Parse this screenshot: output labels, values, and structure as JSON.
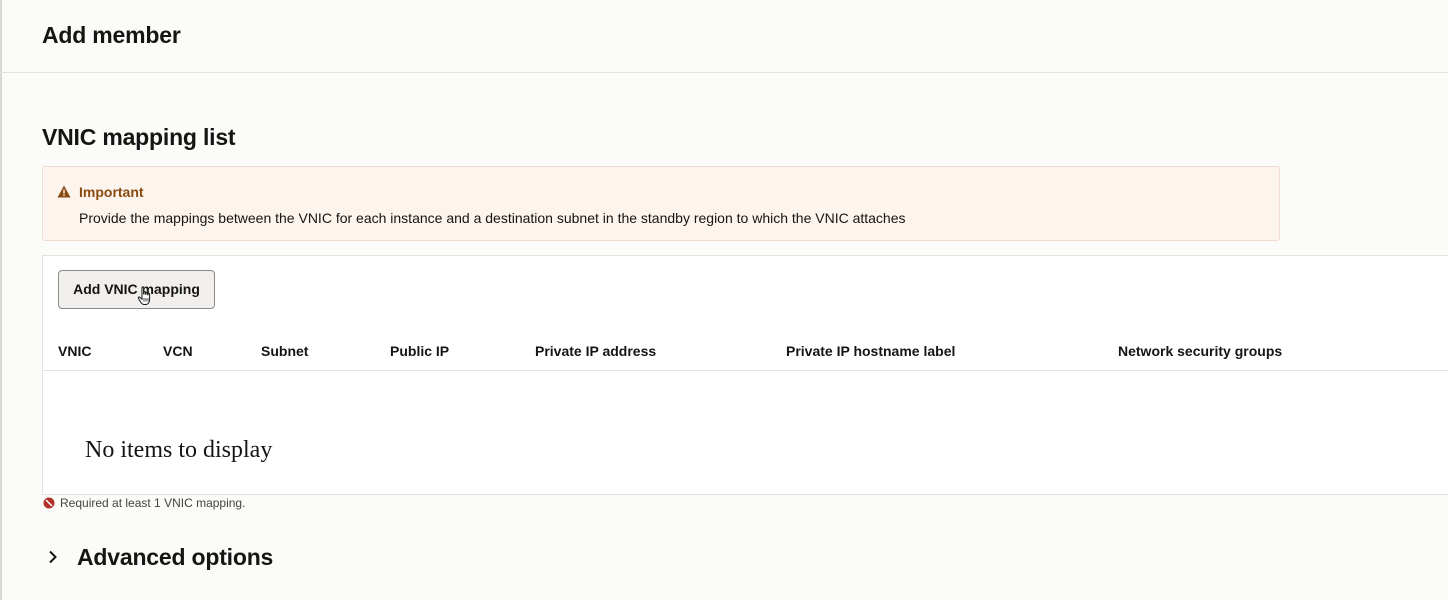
{
  "page": {
    "title": "Add member"
  },
  "section": {
    "title": "VNIC mapping list"
  },
  "notice": {
    "icon": "warning-icon",
    "title": "Important",
    "body": "Provide the mappings between the VNIC for each instance and a destination subnet in the standby region to which the VNIC attaches",
    "accent_color": "#8a4b12",
    "background_color": "#fcf4ed"
  },
  "table": {
    "add_button_label": "Add VNIC mapping",
    "columns": [
      "VNIC",
      "VCN",
      "Subnet",
      "Public IP",
      "Private IP address",
      "Private IP hostname label",
      "Network security groups"
    ],
    "empty_text": "No items to display"
  },
  "validation": {
    "icon": "error-icon",
    "message": "Required at least 1 VNIC mapping.",
    "color": "#b3312a"
  },
  "advanced": {
    "icon": "chevron-right-icon",
    "label": "Advanced options"
  }
}
